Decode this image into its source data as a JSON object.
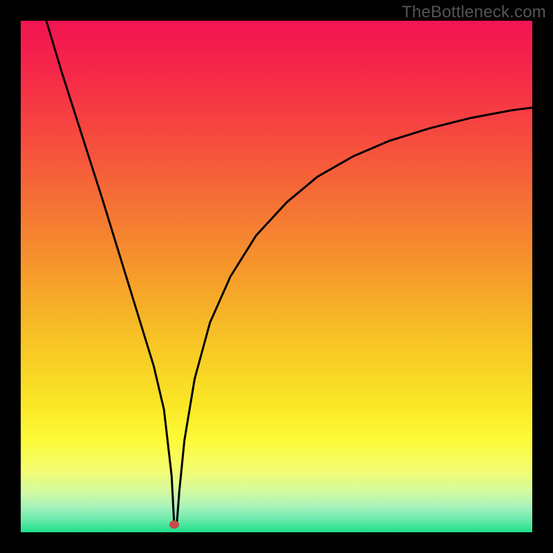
{
  "watermark": "TheBottleneck.com",
  "colors": {
    "background": "#000000",
    "curve": "#000000",
    "marker": "#c24d4a",
    "gradient_stops": [
      {
        "offset": 0.0,
        "color": "#f21452"
      },
      {
        "offset": 0.07,
        "color": "#f5214c"
      },
      {
        "offset": 0.15,
        "color": "#f63545"
      },
      {
        "offset": 0.25,
        "color": "#f6513d"
      },
      {
        "offset": 0.35,
        "color": "#f56f35"
      },
      {
        "offset": 0.45,
        "color": "#f58d2e"
      },
      {
        "offset": 0.55,
        "color": "#f6ad28"
      },
      {
        "offset": 0.65,
        "color": "#f8cb25"
      },
      {
        "offset": 0.75,
        "color": "#fae726"
      },
      {
        "offset": 0.82,
        "color": "#fdfb37"
      },
      {
        "offset": 0.88,
        "color": "#f3fc71"
      },
      {
        "offset": 0.92,
        "color": "#d4faa0"
      },
      {
        "offset": 0.95,
        "color": "#a6f3bb"
      },
      {
        "offset": 0.975,
        "color": "#6be9ac"
      },
      {
        "offset": 1.0,
        "color": "#1ce08a"
      }
    ]
  },
  "chart_data": {
    "type": "line",
    "title": "",
    "xlabel": "",
    "ylabel": "",
    "xlim": [
      0,
      100
    ],
    "ylim": [
      0,
      100
    ],
    "series": [
      {
        "name": "curve",
        "x": [
          5,
          8,
          12,
          16,
          20,
          24,
          26,
          28,
          29.5,
          30,
          30.5,
          31,
          32,
          34,
          37,
          41,
          46,
          52,
          58,
          65,
          72,
          80,
          88,
          96,
          100
        ],
        "y": [
          100,
          90,
          77.5,
          65,
          52,
          39,
          32.5,
          24,
          11,
          1.5,
          1.5,
          8,
          18,
          30,
          41,
          50,
          58,
          64.5,
          69.5,
          73.5,
          76.5,
          79,
          81,
          82.5,
          83
        ]
      }
    ],
    "marker": {
      "x": 30,
      "y": 1.5,
      "r": 1.3
    }
  }
}
